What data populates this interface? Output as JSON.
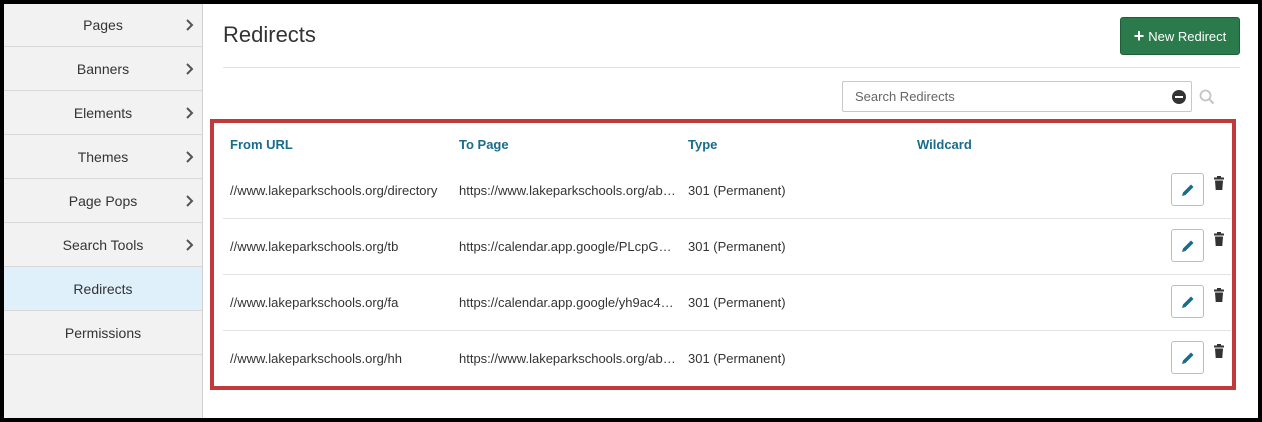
{
  "sidebar": {
    "items": [
      {
        "label": "Pages",
        "has_chevron": true
      },
      {
        "label": "Banners",
        "has_chevron": true
      },
      {
        "label": "Elements",
        "has_chevron": true
      },
      {
        "label": "Themes",
        "has_chevron": true
      },
      {
        "label": "Page Pops",
        "has_chevron": true
      },
      {
        "label": "Search Tools",
        "has_chevron": true
      },
      {
        "label": "Redirects",
        "active": true
      },
      {
        "label": "Permissions"
      }
    ]
  },
  "header": {
    "title": "Redirects",
    "new_button_icon": "+",
    "new_button_label": "New Redirect"
  },
  "search": {
    "placeholder": "Search Redirects",
    "value": ""
  },
  "table": {
    "columns": [
      "From URL",
      "To Page",
      "Type",
      "Wildcard"
    ],
    "rows": [
      {
        "from": "//www.lakeparkschools.org/directory",
        "to": "https://www.lakeparkschools.org/ab…",
        "type": "301 (Permanent)",
        "wildcard": ""
      },
      {
        "from": "//www.lakeparkschools.org/tb",
        "to": "https://calendar.app.google/PLcpGB…",
        "type": "301 (Permanent)",
        "wildcard": ""
      },
      {
        "from": "//www.lakeparkschools.org/fa",
        "to": "https://calendar.app.google/yh9ac4…",
        "type": "301 (Permanent)",
        "wildcard": ""
      },
      {
        "from": "//www.lakeparkschools.org/hh",
        "to": "https://www.lakeparkschools.org/ab…",
        "type": "301 (Permanent)",
        "wildcard": ""
      }
    ]
  },
  "colors": {
    "primary_button": "#2a7a4b",
    "header_link": "#1a6b8c",
    "highlight_border": "#c0393b",
    "sidebar_active": "#dff0fa",
    "edit_icon": "#1a6b8c"
  }
}
